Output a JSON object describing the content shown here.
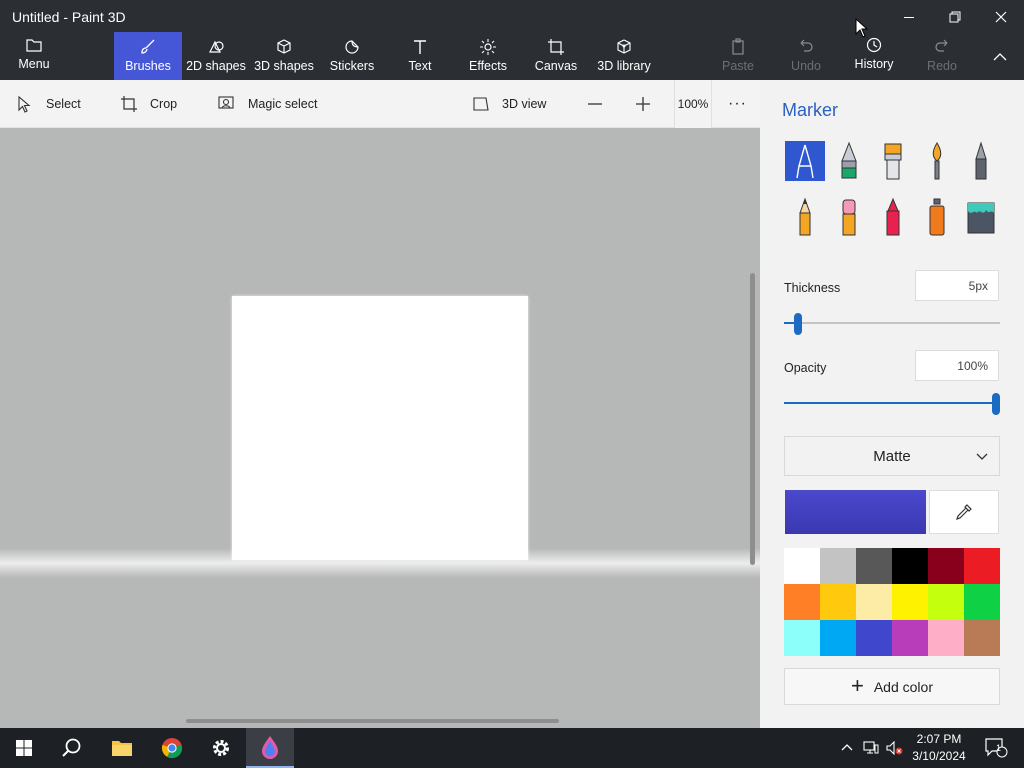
{
  "window": {
    "title": "Untitled - Paint 3D",
    "minimize_glyph": "—",
    "restore_glyph": "❐",
    "close_glyph": "✕"
  },
  "ribbon": {
    "menu": "Menu",
    "brushes": "Brushes",
    "shapes2d": "2D shapes",
    "shapes3d": "3D shapes",
    "stickers": "Stickers",
    "text": "Text",
    "effects": "Effects",
    "canvas": "Canvas",
    "library3d": "3D library",
    "paste": "Paste",
    "undo": "Undo",
    "history": "History",
    "redo": "Redo",
    "active_color": "#4557d6"
  },
  "toolbar": {
    "select": "Select",
    "crop": "Crop",
    "magic_select": "Magic select",
    "view3d": "3D view",
    "zoom": "100%",
    "more_glyph": "···"
  },
  "panel": {
    "title": "Marker",
    "brushes": [
      {
        "name": "marker",
        "selected": true
      },
      {
        "name": "calligraphy-pen"
      },
      {
        "name": "oil-brush"
      },
      {
        "name": "watercolor"
      },
      {
        "name": "pixel-pen"
      },
      {
        "name": "pencil"
      },
      {
        "name": "eraser"
      },
      {
        "name": "crayon"
      },
      {
        "name": "spray-can"
      },
      {
        "name": "fill"
      }
    ],
    "thickness_label": "Thickness",
    "thickness_value": "5px",
    "thickness_fraction": 0.05,
    "opacity_label": "Opacity",
    "opacity_value": "100%",
    "opacity_fraction": 1.0,
    "finish": "Matte",
    "current_color": "#4b49cc",
    "palette": [
      "#ffffff",
      "#c3c3c3",
      "#585858",
      "#000000",
      "#88001b",
      "#ec1c24",
      "#ff7f27",
      "#ffc90e",
      "#fdeca6",
      "#fff200",
      "#c4ff0e",
      "#0ed145",
      "#8cfffb",
      "#00a8f3",
      "#3f48cc",
      "#b83dba",
      "#ffaec8",
      "#b97a56"
    ],
    "add_color": "Add color"
  },
  "taskbar": {
    "time": "2:07 PM",
    "date": "3/10/2024",
    "notification_count": "1"
  }
}
